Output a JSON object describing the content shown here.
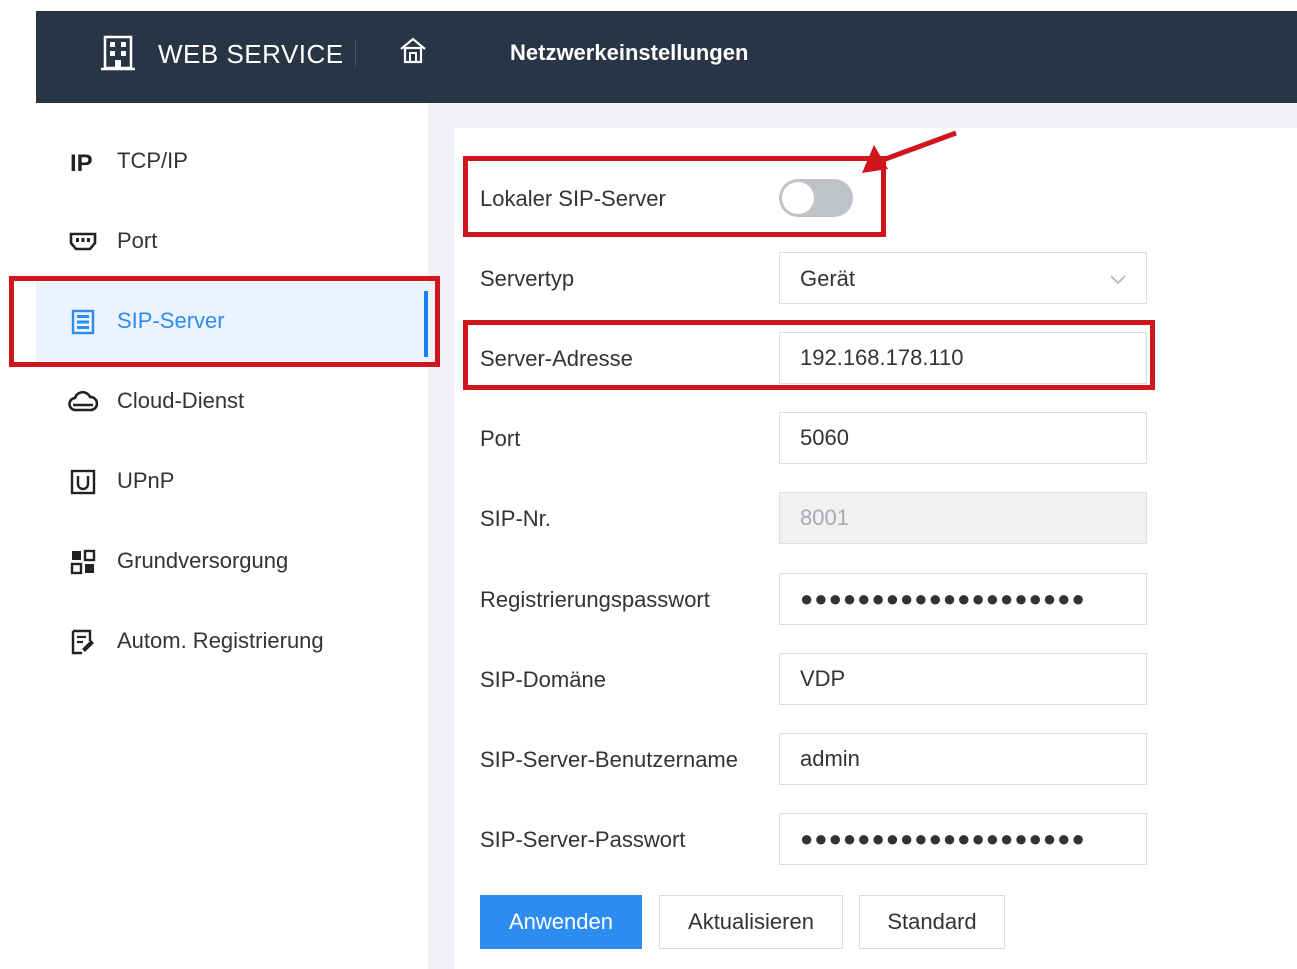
{
  "header": {
    "brand": "WEB SERVICE",
    "page_title": "Netzwerkeinstellungen",
    "brand_icon": "building-icon",
    "home_icon": "home-icon"
  },
  "sidebar": {
    "items": [
      {
        "label": "TCP/IP",
        "icon": "ip-icon"
      },
      {
        "label": "Port",
        "icon": "port-icon"
      },
      {
        "label": "SIP-Server",
        "icon": "sip-server-icon",
        "active": true
      },
      {
        "label": "Cloud-Dienst",
        "icon": "cloud-icon"
      },
      {
        "label": "UPnP",
        "icon": "upnp-icon"
      },
      {
        "label": "Grundversorgung",
        "icon": "grid-icon"
      },
      {
        "label": "Autom. Registrierung",
        "icon": "register-icon"
      }
    ]
  },
  "form": {
    "local_sip": {
      "label": "Lokaler SIP-Server",
      "enabled": false
    },
    "server_type": {
      "label": "Servertyp",
      "value": "Gerät"
    },
    "server_address": {
      "label": "Server-Adresse",
      "value": "192.168.178.110"
    },
    "port": {
      "label": "Port",
      "value": "5060"
    },
    "sip_number": {
      "label": "SIP-Nr.",
      "value": "8001"
    },
    "reg_password": {
      "label": "Registrierungspasswort",
      "value": "●●●●●●●●●●●●●●●●●●●●"
    },
    "sip_domain": {
      "label": "SIP-Domäne",
      "value": "VDP"
    },
    "sip_username": {
      "label": "SIP-Server-Benutzername",
      "value": "admin"
    },
    "sip_password": {
      "label": "SIP-Server-Passwort",
      "value": "●●●●●●●●●●●●●●●●●●●●"
    }
  },
  "buttons": {
    "apply": "Anwenden",
    "refresh": "Aktualisieren",
    "default": "Standard"
  },
  "colors": {
    "header_bg": "#283544",
    "accent": "#2d8cf0",
    "highlight_box": "#d0161c",
    "active_nav_bg": "#eaf3ff"
  }
}
